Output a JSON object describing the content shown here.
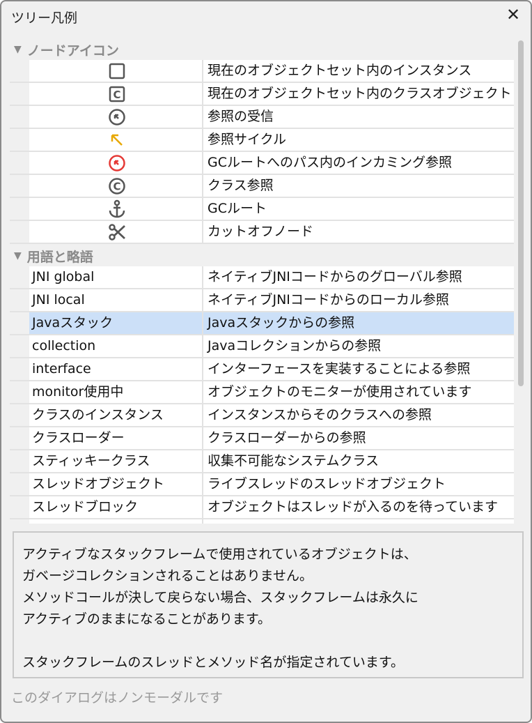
{
  "window": {
    "title": "ツリー凡例",
    "close": "✕"
  },
  "sections": [
    {
      "title": "ノードアイコン",
      "rows": [
        {
          "icon": "square-icon",
          "desc": "現在のオブジェクトセット内のインスタンス"
        },
        {
          "icon": "class-box-icon",
          "desc": "現在のオブジェクトセット内のクラスオブジェクト"
        },
        {
          "icon": "incoming-reference-icon",
          "desc": "参照の受信"
        },
        {
          "icon": "reference-cycle-icon",
          "desc": "参照サイクル"
        },
        {
          "icon": "gc-root-path-icon",
          "desc": "GCルートへのパス内のインカミング参照"
        },
        {
          "icon": "class-reference-icon",
          "desc": "クラス参照"
        },
        {
          "icon": "anchor-icon",
          "desc": "GCルート"
        },
        {
          "icon": "scissors-icon",
          "desc": "カットオフノード"
        }
      ]
    },
    {
      "title": "用語と略語",
      "rows": [
        {
          "term": "JNI global",
          "desc": "ネイティブJNIコードからのグローバル参照"
        },
        {
          "term": "JNI local",
          "desc": "ネイティブJNIコードからのローカル参照"
        },
        {
          "term": "Javaスタック",
          "desc": "Javaスタックからの参照",
          "selected": true
        },
        {
          "term": "collection",
          "desc": "Javaコレクションからの参照"
        },
        {
          "term": "interface",
          "desc": "インターフェースを実装することによる参照"
        },
        {
          "term": "monitor使用中",
          "desc": "オブジェクトのモニターが使用されています"
        },
        {
          "term": "クラスのインスタンス",
          "desc": "インスタンスからそのクラスへの参照"
        },
        {
          "term": "クラスローダー",
          "desc": "クラスローダーからの参照"
        },
        {
          "term": "スティッキークラス",
          "desc": "収集不可能なシステムクラス"
        },
        {
          "term": "スレッドオブジェクト",
          "desc": "ライブスレッドのスレッドオブジェクト"
        },
        {
          "term": "スレッドブロック",
          "desc": "オブジェクトはスレッドが入るのを待っています"
        }
      ]
    }
  ],
  "description": "アクティブなスタックフレームで使用されているオブジェクトは、\nガベージコレクションされることはありません。\nメソッドコールが決して戻らない場合、スタックフレームは永久に\nアクティブのままになることがあります。\n\nスタックフレームのスレッドとメソッド名が指定されています。",
  "footer": "このダイアログはノンモーダルです",
  "colors": {
    "selection": "#cce0f8",
    "cycle": "#e8a800",
    "gcpath": "#e53935",
    "icon": "#555555"
  }
}
